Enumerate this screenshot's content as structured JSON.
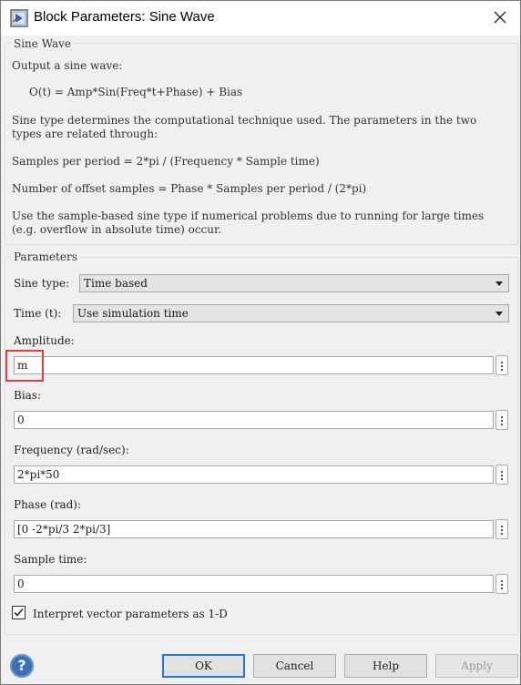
{
  "window": {
    "title": "Block Parameters: Sine Wave"
  },
  "description": {
    "legend": "Sine Wave",
    "lines": [
      "Output a sine wave:",
      "O(t) = Amp*Sin(Freq*t+Phase) + Bias",
      "Sine type determines the computational technique used. The parameters in the two",
      "types are related through:",
      "Samples per period = 2*pi / (Frequency * Sample time)",
      "Number of offset samples = Phase * Samples per period / (2*pi)",
      "Use the sample-based sine type if numerical problems due to running for large times",
      "(e.g. overflow in absolute time) occur."
    ]
  },
  "parameters": {
    "legend": "Parameters",
    "sine_type": {
      "label": "Sine type:",
      "value": "Time based"
    },
    "time": {
      "label": "Time (t):",
      "value": "Use simulation time"
    },
    "amplitude": {
      "label": "Amplitude:",
      "value": "m"
    },
    "bias": {
      "label": "Bias:",
      "value": "0"
    },
    "frequency": {
      "label": "Frequency (rad/sec):",
      "value": "2*pi*50"
    },
    "phase": {
      "label": "Phase (rad):",
      "value": "[0 -2*pi/3 2*pi/3]"
    },
    "sample_time": {
      "label": "Sample time:",
      "value": "0"
    },
    "interpret": {
      "label": "Interpret vector parameters as 1-D",
      "checked": true
    }
  },
  "buttons": {
    "ok": "OK",
    "cancel": "Cancel",
    "help": "Help",
    "apply": "Apply",
    "help_icon": "?"
  },
  "colors": {
    "highlight": "#e0413c",
    "accent": "#2b74d4",
    "help_icon": "#3c6fb6"
  }
}
